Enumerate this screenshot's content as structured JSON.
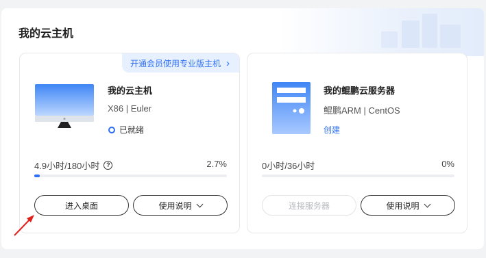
{
  "panel": {
    "title": "我的云主机"
  },
  "cards": [
    {
      "promo": "开通会员使用专业版主机",
      "name": "我的云主机",
      "spec": "X86 | Euler",
      "status": "已就绪",
      "usage": "4.9小时/180小时",
      "percent": "2.7%",
      "progress": 0.027,
      "primary_button": "进入桌面",
      "secondary_button": "使用说明"
    },
    {
      "name": "我的鲲鹏云服务器",
      "spec": "鲲鹏ARM | CentOS",
      "action_link": "创建",
      "usage": "0小时/36小时",
      "percent": "0%",
      "progress": 0,
      "primary_button": "连接服务器",
      "secondary_button": "使用说明"
    }
  ],
  "colors": {
    "accent": "#2f6ff3",
    "annotation_arrow": "#e0201b"
  },
  "icons": {
    "promo": "chevron-right-icon",
    "help": "question-circle-icon",
    "dropdown": "chevron-down-icon",
    "status": "ready-dot-icon"
  }
}
